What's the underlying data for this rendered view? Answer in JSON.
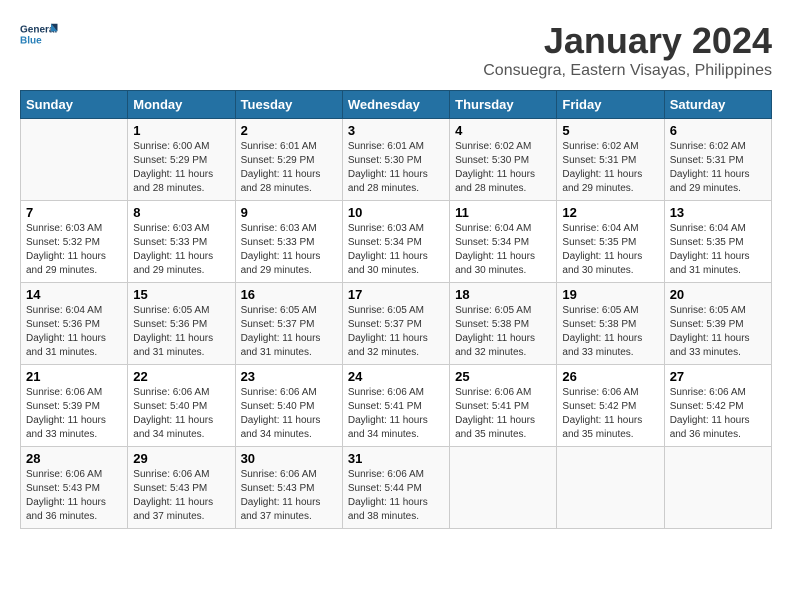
{
  "header": {
    "logo_general": "General",
    "logo_blue": "Blue",
    "month_year": "January 2024",
    "location": "Consuegra, Eastern Visayas, Philippines"
  },
  "days_of_week": [
    "Sunday",
    "Monday",
    "Tuesday",
    "Wednesday",
    "Thursday",
    "Friday",
    "Saturday"
  ],
  "weeks": [
    [
      {
        "day": "",
        "sunrise": "",
        "sunset": "",
        "daylight": ""
      },
      {
        "day": "1",
        "sunrise": "Sunrise: 6:00 AM",
        "sunset": "Sunset: 5:29 PM",
        "daylight": "Daylight: 11 hours and 28 minutes."
      },
      {
        "day": "2",
        "sunrise": "Sunrise: 6:01 AM",
        "sunset": "Sunset: 5:29 PM",
        "daylight": "Daylight: 11 hours and 28 minutes."
      },
      {
        "day": "3",
        "sunrise": "Sunrise: 6:01 AM",
        "sunset": "Sunset: 5:30 PM",
        "daylight": "Daylight: 11 hours and 28 minutes."
      },
      {
        "day": "4",
        "sunrise": "Sunrise: 6:02 AM",
        "sunset": "Sunset: 5:30 PM",
        "daylight": "Daylight: 11 hours and 28 minutes."
      },
      {
        "day": "5",
        "sunrise": "Sunrise: 6:02 AM",
        "sunset": "Sunset: 5:31 PM",
        "daylight": "Daylight: 11 hours and 29 minutes."
      },
      {
        "day": "6",
        "sunrise": "Sunrise: 6:02 AM",
        "sunset": "Sunset: 5:31 PM",
        "daylight": "Daylight: 11 hours and 29 minutes."
      }
    ],
    [
      {
        "day": "7",
        "sunrise": "Sunrise: 6:03 AM",
        "sunset": "Sunset: 5:32 PM",
        "daylight": "Daylight: 11 hours and 29 minutes."
      },
      {
        "day": "8",
        "sunrise": "Sunrise: 6:03 AM",
        "sunset": "Sunset: 5:33 PM",
        "daylight": "Daylight: 11 hours and 29 minutes."
      },
      {
        "day": "9",
        "sunrise": "Sunrise: 6:03 AM",
        "sunset": "Sunset: 5:33 PM",
        "daylight": "Daylight: 11 hours and 29 minutes."
      },
      {
        "day": "10",
        "sunrise": "Sunrise: 6:03 AM",
        "sunset": "Sunset: 5:34 PM",
        "daylight": "Daylight: 11 hours and 30 minutes."
      },
      {
        "day": "11",
        "sunrise": "Sunrise: 6:04 AM",
        "sunset": "Sunset: 5:34 PM",
        "daylight": "Daylight: 11 hours and 30 minutes."
      },
      {
        "day": "12",
        "sunrise": "Sunrise: 6:04 AM",
        "sunset": "Sunset: 5:35 PM",
        "daylight": "Daylight: 11 hours and 30 minutes."
      },
      {
        "day": "13",
        "sunrise": "Sunrise: 6:04 AM",
        "sunset": "Sunset: 5:35 PM",
        "daylight": "Daylight: 11 hours and 31 minutes."
      }
    ],
    [
      {
        "day": "14",
        "sunrise": "Sunrise: 6:04 AM",
        "sunset": "Sunset: 5:36 PM",
        "daylight": "Daylight: 11 hours and 31 minutes."
      },
      {
        "day": "15",
        "sunrise": "Sunrise: 6:05 AM",
        "sunset": "Sunset: 5:36 PM",
        "daylight": "Daylight: 11 hours and 31 minutes."
      },
      {
        "day": "16",
        "sunrise": "Sunrise: 6:05 AM",
        "sunset": "Sunset: 5:37 PM",
        "daylight": "Daylight: 11 hours and 31 minutes."
      },
      {
        "day": "17",
        "sunrise": "Sunrise: 6:05 AM",
        "sunset": "Sunset: 5:37 PM",
        "daylight": "Daylight: 11 hours and 32 minutes."
      },
      {
        "day": "18",
        "sunrise": "Sunrise: 6:05 AM",
        "sunset": "Sunset: 5:38 PM",
        "daylight": "Daylight: 11 hours and 32 minutes."
      },
      {
        "day": "19",
        "sunrise": "Sunrise: 6:05 AM",
        "sunset": "Sunset: 5:38 PM",
        "daylight": "Daylight: 11 hours and 33 minutes."
      },
      {
        "day": "20",
        "sunrise": "Sunrise: 6:05 AM",
        "sunset": "Sunset: 5:39 PM",
        "daylight": "Daylight: 11 hours and 33 minutes."
      }
    ],
    [
      {
        "day": "21",
        "sunrise": "Sunrise: 6:06 AM",
        "sunset": "Sunset: 5:39 PM",
        "daylight": "Daylight: 11 hours and 33 minutes."
      },
      {
        "day": "22",
        "sunrise": "Sunrise: 6:06 AM",
        "sunset": "Sunset: 5:40 PM",
        "daylight": "Daylight: 11 hours and 34 minutes."
      },
      {
        "day": "23",
        "sunrise": "Sunrise: 6:06 AM",
        "sunset": "Sunset: 5:40 PM",
        "daylight": "Daylight: 11 hours and 34 minutes."
      },
      {
        "day": "24",
        "sunrise": "Sunrise: 6:06 AM",
        "sunset": "Sunset: 5:41 PM",
        "daylight": "Daylight: 11 hours and 34 minutes."
      },
      {
        "day": "25",
        "sunrise": "Sunrise: 6:06 AM",
        "sunset": "Sunset: 5:41 PM",
        "daylight": "Daylight: 11 hours and 35 minutes."
      },
      {
        "day": "26",
        "sunrise": "Sunrise: 6:06 AM",
        "sunset": "Sunset: 5:42 PM",
        "daylight": "Daylight: 11 hours and 35 minutes."
      },
      {
        "day": "27",
        "sunrise": "Sunrise: 6:06 AM",
        "sunset": "Sunset: 5:42 PM",
        "daylight": "Daylight: 11 hours and 36 minutes."
      }
    ],
    [
      {
        "day": "28",
        "sunrise": "Sunrise: 6:06 AM",
        "sunset": "Sunset: 5:43 PM",
        "daylight": "Daylight: 11 hours and 36 minutes."
      },
      {
        "day": "29",
        "sunrise": "Sunrise: 6:06 AM",
        "sunset": "Sunset: 5:43 PM",
        "daylight": "Daylight: 11 hours and 37 minutes."
      },
      {
        "day": "30",
        "sunrise": "Sunrise: 6:06 AM",
        "sunset": "Sunset: 5:43 PM",
        "daylight": "Daylight: 11 hours and 37 minutes."
      },
      {
        "day": "31",
        "sunrise": "Sunrise: 6:06 AM",
        "sunset": "Sunset: 5:44 PM",
        "daylight": "Daylight: 11 hours and 38 minutes."
      },
      {
        "day": "",
        "sunrise": "",
        "sunset": "",
        "daylight": ""
      },
      {
        "day": "",
        "sunrise": "",
        "sunset": "",
        "daylight": ""
      },
      {
        "day": "",
        "sunrise": "",
        "sunset": "",
        "daylight": ""
      }
    ]
  ]
}
